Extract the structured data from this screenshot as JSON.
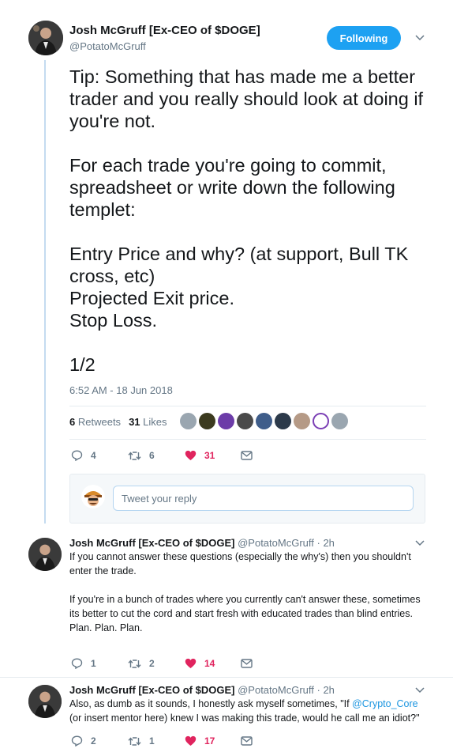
{
  "main_tweet": {
    "author_name": "Josh McGruff [Ex-CEO of $DOGE]",
    "author_handle": "@PotatoMcGruff",
    "follow_label": "Following",
    "text": "Tip: Something that has made me a better trader and you really should look at doing if you're not.\n\nFor each trade you're going to commit, spreadsheet or write down the following templet:\n\nEntry Price and why? (at support, Bull TK cross, etc)\nProjected Exit price.\nStop Loss.\n\n1/2",
    "timestamp": "6:52 AM - 18 Jun 2018",
    "retweets_count": "6",
    "retweets_label": "Retweets",
    "likes_count": "31",
    "likes_label": "Likes",
    "liker_colors": [
      "#9aa6b0",
      "#3b3a1e",
      "#6c3ca8",
      "#4a4a4a",
      "#3f5d8a",
      "#2c3a4a",
      "#b59a86",
      "#ffffff",
      "#9aa6b0"
    ],
    "actions": {
      "replies": "4",
      "retweets": "6",
      "likes": "31"
    }
  },
  "reply_box": {
    "placeholder": "Tweet your reply"
  },
  "replies": [
    {
      "author_name": "Josh McGruff [Ex-CEO of $DOGE]",
      "author_handle": "@PotatoMcGruff",
      "time": "2h",
      "text": "If you cannot answer these questions (especially the why's) then you shouldn't enter the trade.\n\nIf you're in a bunch of trades where you currently can't answer these, sometimes its better to cut the cord and start fresh with educated trades than blind entries.\nPlan. Plan. Plan.",
      "actions": {
        "replies": "1",
        "retweets": "2",
        "likes": "14"
      }
    },
    {
      "author_name": "Josh McGruff [Ex-CEO of $DOGE]",
      "author_handle": "@PotatoMcGruff",
      "time": "2h",
      "text_before": "Also, as dumb as it sounds, I honestly ask myself sometimes, \"If ",
      "mention": "@Crypto_Core",
      "text_after": "\n(or insert mentor here) knew I was making this trade, would he call me an idiot?\"",
      "actions": {
        "replies": "2",
        "retweets": "1",
        "likes": "17"
      }
    }
  ],
  "colors": {
    "accent": "#1da1f2",
    "like": "#e0245e",
    "secondary_text": "#657786",
    "thread_line": "#c4dbf0"
  }
}
